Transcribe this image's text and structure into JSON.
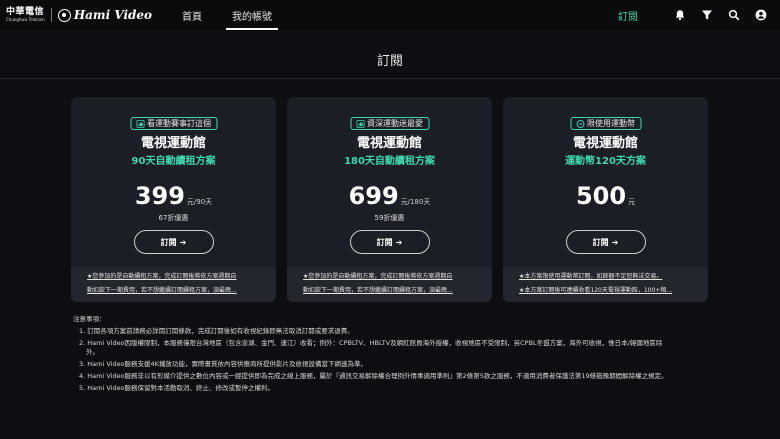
{
  "header": {
    "brand_zh": "中華電信",
    "brand_en": "Chunghwa Telecom",
    "app_name": "Hami Video",
    "nav": [
      {
        "label": "首頁",
        "active": false
      },
      {
        "label": "我的帳號",
        "active": true
      }
    ],
    "subscribe_link": "訂閱",
    "icons": [
      "bell-icon",
      "filter-icon",
      "search-icon",
      "user-icon"
    ]
  },
  "page": {
    "title": "訂閱"
  },
  "accent_color": "#3fd6b0",
  "plans": [
    {
      "tag_icon": "thumbs-up-icon",
      "tag": "看運動賽事訂這個",
      "title": "電視運動館",
      "subtitle": "90天自動續租方案",
      "price": "399",
      "unit": "元/90天",
      "discount": "67折優惠",
      "button_label": "訂閱",
      "notes": [
        "★您參加的是自動續租方案，完成訂閱後將依方案週期自",
        "動扣款下一期費用，若不想繼續訂閱續租方案，須最晚..."
      ]
    },
    {
      "tag_icon": "thumbs-up-icon",
      "tag": "資深運動迷最愛",
      "title": "電視運動館",
      "subtitle": "180天自動續租方案",
      "price": "699",
      "unit": "元/180天",
      "discount": "59折優惠",
      "button_label": "訂閱",
      "notes": [
        "★您參加的是自動續租方案，完成訂閱後將依方案週期自",
        "動扣款下一期費用，若不想繼續訂閱續租方案，須最晚..."
      ]
    },
    {
      "tag_icon": "minus-circle-icon",
      "tag": "限使用運動幣",
      "title": "電視運動館",
      "subtitle": "運動幣120天方案",
      "price": "500",
      "unit": "元",
      "discount": "",
      "button_label": "訂閱",
      "notes": [
        "★本方案限使用運動幣訂閱，如餘額不足恕無法交易。",
        "★本方案訂閱後可連續收看120天電視運動館，100+頻..."
      ]
    }
  ],
  "footnotes": {
    "heading": "注意事項：",
    "items": [
      {
        "text": "1. 訂閱各項方案前請務必詳閱訂閱條款，完成訂閱後如有收視紀錄即無法取消訂閱或要求退費。",
        "cont": ""
      },
      {
        "text": "2. Hami Video因版權限制，本服務僅限台灣地區（包含澎湖、金門、連江）收看；例外：CPBLTV、HBLTV及網紅館員海外授權，收視地區不受限制，另CPBL冬盟方案，海外可收視，惟日本/韓國地區除",
        "cont": "外。"
      },
      {
        "text": "3. Hami Video服務支援4K播放功能，實際畫質依內容供應商所提供影片及收視設備當下網速為準。",
        "cont": ""
      },
      {
        "text": "4. Hami Video服務非以有形媒介提供之數位內容或一經提供即為完成之線上服務，屬於『通訊交易解除權合理例外情事適用準則』第2條第5款之服務，不適用消費者保護法第19條猶豫期間解除權之規定。",
        "cont": ""
      },
      {
        "text": "5. Hami Video服務保留對本活動取消、終止、修改或暫停之權利。",
        "cont": ""
      }
    ]
  }
}
